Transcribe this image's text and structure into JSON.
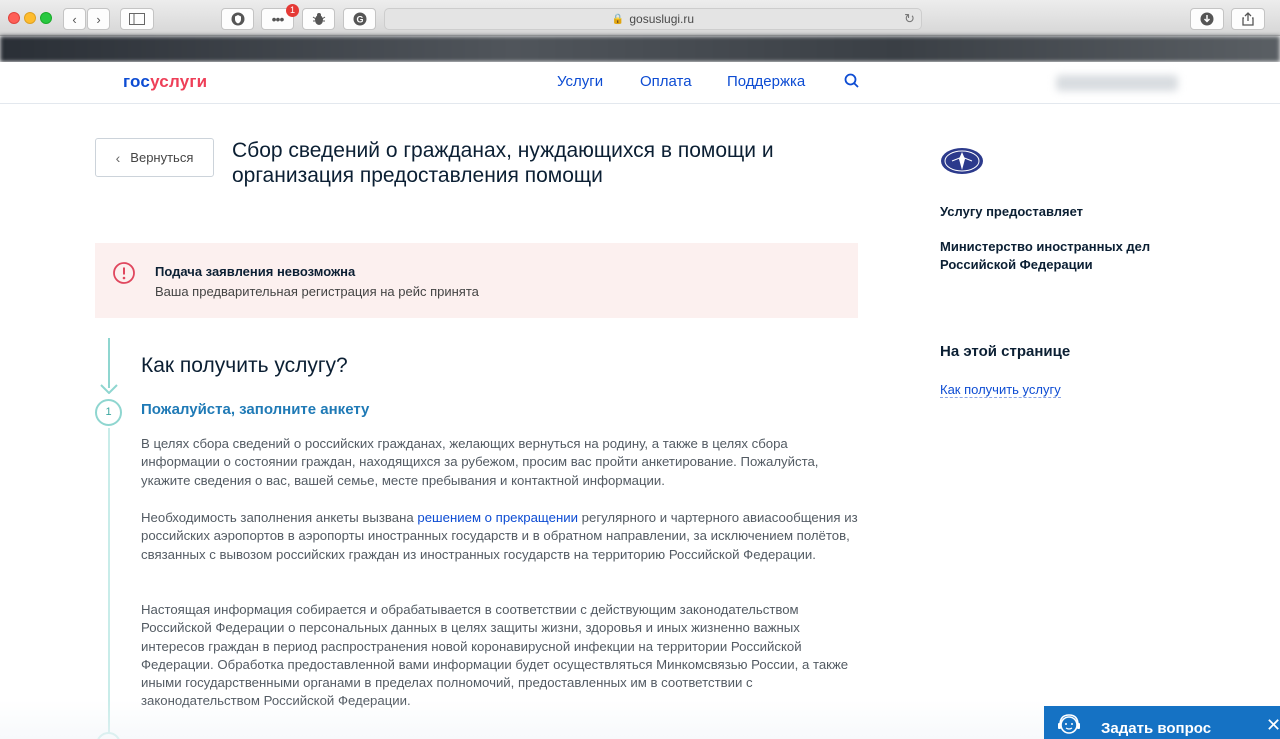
{
  "browser": {
    "url": "gosuslugi.ru",
    "notification_count": "1"
  },
  "header": {
    "logo_part1": "гос",
    "logo_part2": "услуги",
    "nav": [
      "Услуги",
      "Оплата",
      "Поддержка"
    ]
  },
  "page": {
    "back_label": "Вернуться",
    "title": "Сбор сведений о гражданах, нуждающихся в помощи и организация предоставления помощи"
  },
  "alert": {
    "title": "Подача заявления невозможна",
    "text": "Ваша предварительная регистрация на рейс принята"
  },
  "main": {
    "section_title": "Как получить услугу?",
    "step_number": "1",
    "step_title": "Пожалуйста, заполните анкету",
    "p1": "В целях сбора сведений о российских гражданах, желающих вернуться на родину, а также в целях сбора информации о состоянии граждан, находящихся за рубежом, просим вас пройти анкетирование. Пожалуйста, укажите сведения о вас, вашей семье, месте пребывания и контактной информации.",
    "p2_before": "Необходимость заполнения анкеты вызвана ",
    "p2_link": "решением о прекращении",
    "p2_after": " регулярного и чартерного авиасообщения из российских аэропортов в аэропорты иностранных государств и в обратном направлении, за исключением полётов, связанных с вывозом российских граждан из иностранных государств на территорию Российской Федерации.",
    "p3": "Настоящая информация собирается и обрабатывается в соответствии с действующим законодательством Российской Федерации о персональных данных в целях защиты жизни, здоровья и иных жизненно важных интересов граждан в период распространения новой коронавирусной инфекции на территории Российской Федерации. Обработка предоставленной вами информации будет осуществляться Минкомсвязью России, а также иными государственными органами в пределах полномочий, предоставленных им в соответствии с законодательством Российской Федерации."
  },
  "sidebar": {
    "provider_label": "Услугу предоставляет",
    "provider_name": "Министерство иностранных дел Российской Федерации",
    "on_page_title": "На этой странице",
    "toc_link": "Как получить услугу"
  },
  "ask_widget": {
    "label": "Задать вопрос",
    "close": "✕"
  },
  "colors": {
    "brand_blue": "#0d4cd3",
    "brand_red": "#ee3f58",
    "alert_bg": "#fcf0ef",
    "alert_icon": "#e0475e",
    "step_teal": "#8fd6d0",
    "step_title": "#1f7ab6",
    "widget_blue": "#1572c4"
  }
}
